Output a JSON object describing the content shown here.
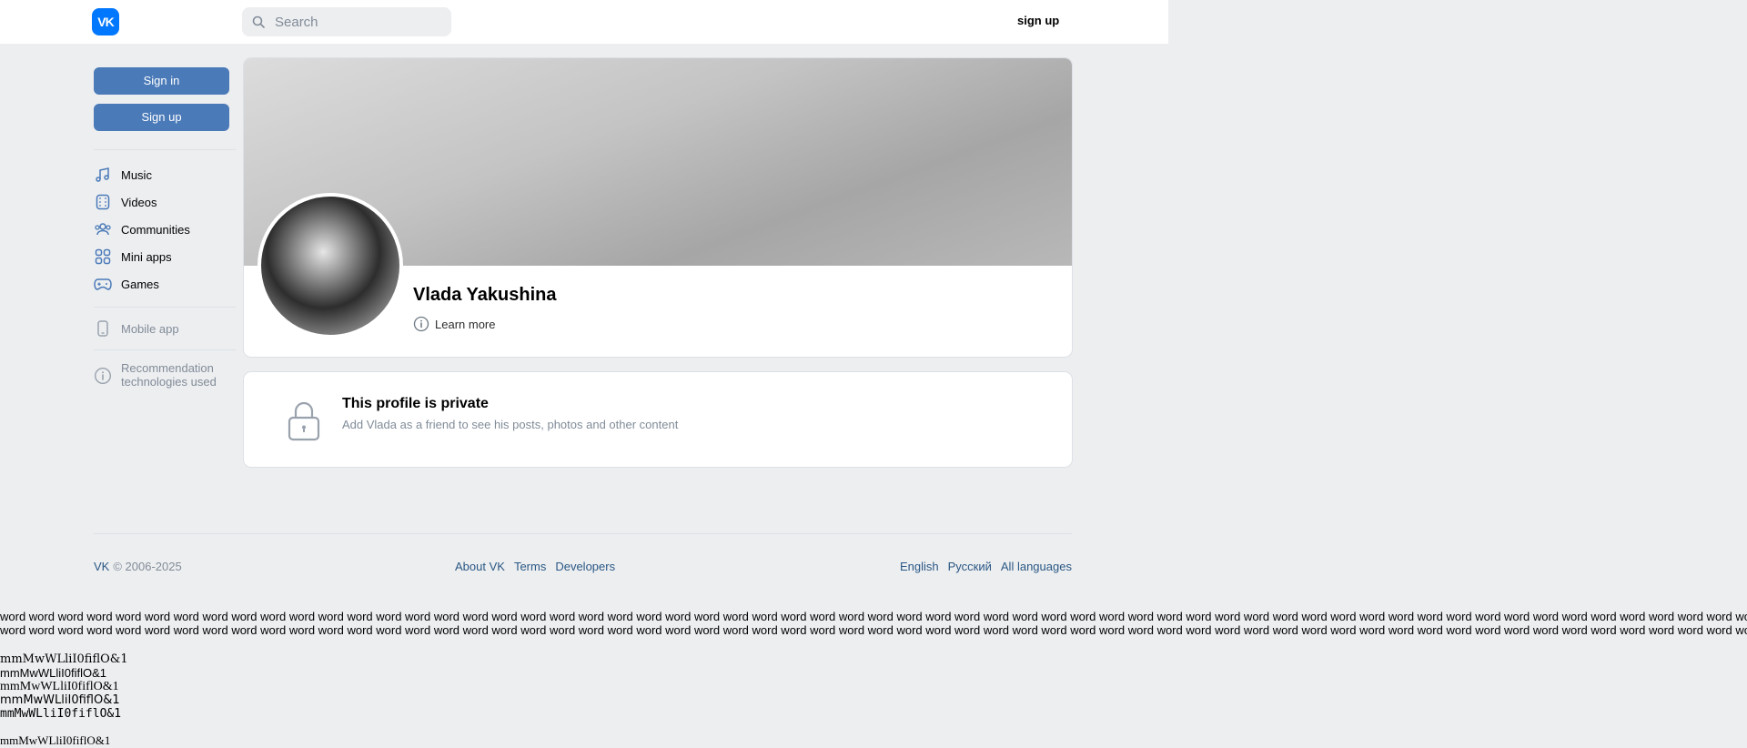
{
  "header": {
    "logo_text": "VK",
    "search_placeholder": "Search",
    "signup_label": "sign up"
  },
  "sidebar": {
    "signin_label": "Sign in",
    "signup_label": "Sign up",
    "items": [
      {
        "label": "Music",
        "icon": "music-icon"
      },
      {
        "label": "Videos",
        "icon": "video-icon"
      },
      {
        "label": "Communities",
        "icon": "communities-icon"
      },
      {
        "label": "Mini apps",
        "icon": "mini-apps-icon"
      },
      {
        "label": "Games",
        "icon": "gamepad-icon"
      }
    ],
    "mobile_app_label": "Mobile app",
    "reco_line1": "Recommendation",
    "reco_line2": "technologies used"
  },
  "profile": {
    "name": "Vlada Yakushina",
    "learn_more": "Learn more"
  },
  "private": {
    "title": "This profile is private",
    "subtitle": "Add Vlada as a friend to see his posts, photos and other content"
  },
  "footer": {
    "copyright_brand": "VK",
    "copyright_years": "© 2006-2025",
    "links": [
      "About VK",
      "Terms",
      "Developers"
    ],
    "languages": [
      "English",
      "Русский",
      "All languages"
    ]
  },
  "filler": {
    "line1": "word word word word word word word word word word word word word word word word word word word word word word word word word word word word word word word word word word word word word word word word word word word word word word word word word word word word word word word word word word word word word word",
    "line2": "word word word word word word word word word word word word word word word word word word word word word word word word word word word word word word word word word word word word word word word word word word word word word word word word word word word word word word word word word word word word word word",
    "glyphs": [
      "mmMwWLliI0fiflO&1",
      "mmMwWLliI0fiflO&1",
      "mmMwWLliI0fiflO&1",
      "mmMwWLliI0fiflO&1",
      "mmMwWLliI0fiflO&1",
      "mmMwWLliI0fiflO&1"
    ]
  }
}
